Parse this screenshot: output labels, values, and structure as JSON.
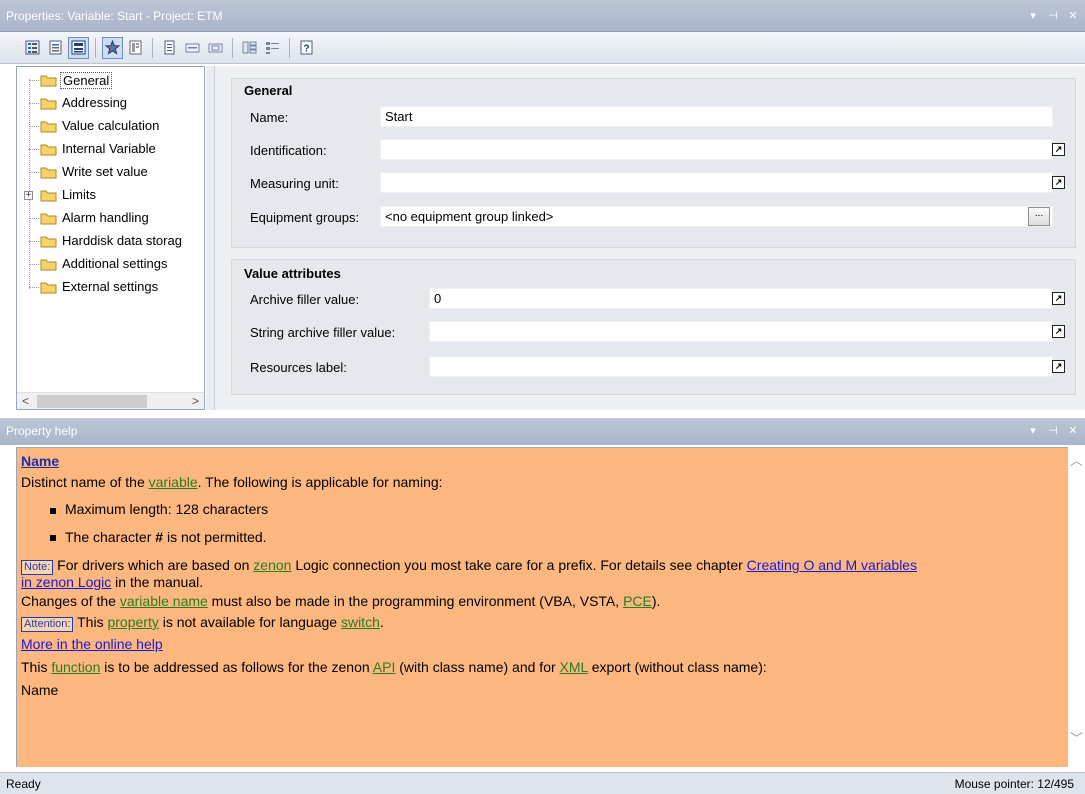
{
  "window": {
    "title": "Properties: Variable: Start - Project: ETM",
    "controls": [
      "▾",
      "⊣",
      "✕"
    ]
  },
  "toolbar": {
    "buttons": [
      {
        "icon": "grouped-view-icon"
      },
      {
        "icon": "alphabetical-view-icon"
      },
      {
        "icon": "tree-view-icon",
        "active": true
      },
      {
        "icon": "favorites-icon",
        "active": true
      },
      {
        "icon": "all-properties-icon"
      },
      {
        "icon": "page-icon"
      },
      {
        "icon": "collapse-icon"
      },
      {
        "icon": "expand-icon"
      },
      {
        "icon": "columns-icon"
      },
      {
        "icon": "list-icon"
      },
      {
        "icon": "help-icon"
      }
    ]
  },
  "tree": {
    "items": [
      {
        "label": "General",
        "selected": true
      },
      {
        "label": "Addressing"
      },
      {
        "label": "Value calculation"
      },
      {
        "label": "Internal Variable"
      },
      {
        "label": "Write set value"
      },
      {
        "label": "Limits",
        "expandable": true
      },
      {
        "label": "Alarm handling"
      },
      {
        "label": "Harddisk data storag"
      },
      {
        "label": "Additional settings"
      },
      {
        "label": "External settings"
      }
    ],
    "scroll_left": "<",
    "scroll_right": ">"
  },
  "properties": {
    "general": {
      "title": "General",
      "rows": [
        {
          "label": "Name:",
          "value": "Start",
          "link": false
        },
        {
          "label": "Identification:",
          "value": "",
          "link": true
        },
        {
          "label": "Measuring unit:",
          "value": "",
          "link": true
        },
        {
          "label": "Equipment groups:",
          "value": "<no equipment group linked>",
          "button": "..."
        }
      ]
    },
    "value_attributes": {
      "title": "Value attributes",
      "rows": [
        {
          "label": "Archive filler value:",
          "value": "0",
          "link": true
        },
        {
          "label": "String archive filler value:",
          "value": "",
          "link": true
        },
        {
          "label": "Resources label:",
          "value": "",
          "link": true
        }
      ]
    }
  },
  "help": {
    "panel_title": "Property help",
    "heading": "Name",
    "line1_pre": "Distinct name of the ",
    "line1_link": "variable",
    "line1_post": ". The following is applicable for naming:",
    "bullet1": "Maximum length: 128 characters",
    "bullet2_pre": "The character ",
    "bullet2_char": "#",
    "bullet2_post": " is not permitted.",
    "note_tag": "Note:",
    "note_pre": " For drivers which are based on ",
    "note_link1": "zenon",
    "note_mid": " Logic connection you most take care for a prefix. For details see chapter ",
    "note_link2a": "Creating O and M variables",
    "note_link2b": "in zenon Logic",
    "note_post": " in the manual.",
    "changes_pre": "Changes of the ",
    "changes_link": "variable name",
    "changes_mid": " must also be made in the programming environment (VBA, VSTA, ",
    "changes_link2": "PCE",
    "changes_post": ").",
    "attention_tag": "Attention:",
    "attention_pre": " This ",
    "attention_link": "property",
    "attention_mid": " is not available for language ",
    "attention_link2": "switch",
    "attention_post": ".",
    "more_link": "More in the online help",
    "func_pre": "This ",
    "func_link": "function",
    "func_mid": " is to be addressed as follows for the zenon ",
    "func_link2": "API",
    "func_mid2": " (with class name) and for ",
    "func_link3": "XML",
    "func_post": " export (without class name):",
    "api_name": "Name"
  },
  "status": {
    "left": "Ready",
    "right": "Mouse pointer: 12/495"
  },
  "colors": {
    "help_bg": "#ffb780",
    "link_green": "#2a7d1e",
    "link_blue": "#1818d8"
  }
}
